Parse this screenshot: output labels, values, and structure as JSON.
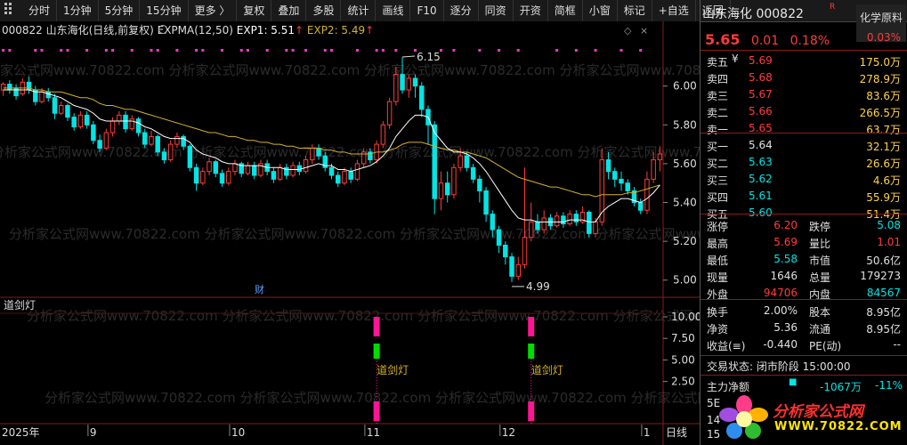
{
  "toolbar": {
    "dots_icon": "grid-dots-icon",
    "items": [
      "分时",
      "1分钟",
      "5分钟",
      "15分钟",
      "更多 〉",
      "复权",
      "叠加",
      "多股",
      "统计",
      "画线",
      "F10",
      "逐分",
      "同资",
      "开资",
      "简框",
      "小窗",
      "标记",
      "+自选",
      "返回"
    ]
  },
  "chart": {
    "info_code": "000822",
    "info_name": "山东海化(日线,前复权)",
    "expma_label": "EXPMA(12,50)",
    "exp1_label": "EXP1: 5.51",
    "exp2_label": "EXP2: 5.49",
    "y_labels": [
      "6.00",
      "5.80",
      "5.60",
      "5.40",
      "5.20",
      "5.00"
    ],
    "high_label": "6.15",
    "low_label": "4.99",
    "cai_label": "财",
    "watermark_text": "分析家公式网www.70822.com",
    "indicator_name": "道剑灯",
    "indicator_y_labels": [
      "10.00",
      "7.50",
      "5.00",
      "2.50"
    ],
    "signal_label": "道剑灯",
    "x_labels": [
      "2025年",
      "9",
      "10",
      "11",
      "12",
      "1"
    ],
    "period_label": "日线",
    "colors": {
      "up": "#ff3b3b",
      "down": "#00e5e5",
      "exp1": "#ffffff",
      "exp2": "#d4b12a",
      "pink": "#ff1493",
      "green": "#00dd00"
    }
  },
  "chart_data": [
    {
      "type": "candlestick",
      "title": "000822 山东海化(日线,前复权)",
      "y_ticks": [
        6.0,
        5.8,
        5.6,
        5.4,
        5.2,
        5.0
      ],
      "ylim": [
        4.93,
        6.26
      ],
      "annotations": {
        "high": 6.15,
        "low": 4.99
      },
      "candles": [
        [
          5.98,
          6.01,
          5.95,
          6.02
        ],
        [
          6.01,
          5.98,
          5.96,
          6.03
        ],
        [
          5.99,
          5.95,
          5.93,
          6.01
        ],
        [
          5.96,
          6.02,
          5.95,
          6.04
        ],
        [
          6.02,
          5.98,
          5.96,
          6.05
        ],
        [
          5.98,
          5.92,
          5.9,
          6.0
        ],
        [
          5.92,
          5.97,
          5.91,
          5.99
        ],
        [
          5.97,
          5.94,
          5.92,
          5.99
        ],
        [
          5.94,
          5.86,
          5.83,
          5.96
        ],
        [
          5.86,
          5.9,
          5.85,
          5.92
        ],
        [
          5.9,
          5.84,
          5.82,
          5.91
        ],
        [
          5.84,
          5.79,
          5.77,
          5.86
        ],
        [
          5.79,
          5.85,
          5.78,
          5.87
        ],
        [
          5.85,
          5.8,
          5.78,
          5.87
        ],
        [
          5.8,
          5.72,
          5.7,
          5.82
        ],
        [
          5.72,
          5.68,
          5.66,
          5.75
        ],
        [
          5.68,
          5.76,
          5.67,
          5.78
        ],
        [
          5.76,
          5.82,
          5.74,
          5.84
        ],
        [
          5.82,
          5.85,
          5.8,
          5.87
        ],
        [
          5.85,
          5.78,
          5.76,
          5.87
        ],
        [
          5.78,
          5.83,
          5.77,
          5.85
        ],
        [
          5.83,
          5.76,
          5.74,
          5.84
        ],
        [
          5.76,
          5.7,
          5.68,
          5.78
        ],
        [
          5.7,
          5.74,
          5.69,
          5.77
        ],
        [
          5.74,
          5.66,
          5.64,
          5.75
        ],
        [
          5.66,
          5.62,
          5.6,
          5.68
        ],
        [
          5.62,
          5.7,
          5.61,
          5.72
        ],
        [
          5.7,
          5.74,
          5.68,
          5.76
        ],
        [
          5.74,
          5.69,
          5.67,
          5.75
        ],
        [
          5.69,
          5.58,
          5.56,
          5.7
        ],
        [
          5.58,
          5.5,
          5.46,
          5.6
        ],
        [
          5.5,
          5.56,
          5.49,
          5.58
        ],
        [
          5.56,
          5.61,
          5.54,
          5.63
        ],
        [
          5.61,
          5.55,
          5.53,
          5.62
        ],
        [
          5.55,
          5.5,
          5.48,
          5.57
        ],
        [
          5.5,
          5.56,
          5.49,
          5.58
        ],
        [
          5.56,
          5.6,
          5.54,
          5.62
        ],
        [
          5.6,
          5.55,
          5.53,
          5.61
        ],
        [
          5.55,
          5.59,
          5.54,
          5.61
        ],
        [
          5.59,
          5.54,
          5.52,
          5.61
        ],
        [
          5.54,
          5.6,
          5.53,
          5.62
        ],
        [
          5.6,
          5.56,
          5.54,
          5.62
        ],
        [
          5.56,
          5.52,
          5.5,
          5.58
        ],
        [
          5.52,
          5.58,
          5.51,
          5.6
        ],
        [
          5.58,
          5.54,
          5.52,
          5.6
        ],
        [
          5.54,
          5.59,
          5.53,
          5.61
        ],
        [
          5.59,
          5.56,
          5.54,
          5.61
        ],
        [
          5.56,
          5.62,
          5.55,
          5.64
        ],
        [
          5.62,
          5.68,
          5.6,
          5.7
        ],
        [
          5.68,
          5.64,
          5.62,
          5.7
        ],
        [
          5.64,
          5.58,
          5.56,
          5.66
        ],
        [
          5.58,
          5.54,
          5.52,
          5.6
        ],
        [
          5.54,
          5.5,
          5.48,
          5.56
        ],
        [
          5.5,
          5.56,
          5.49,
          5.58
        ],
        [
          5.56,
          5.52,
          5.5,
          5.58
        ],
        [
          5.52,
          5.6,
          5.51,
          5.62
        ],
        [
          5.6,
          5.66,
          5.58,
          5.68
        ],
        [
          5.66,
          5.62,
          5.6,
          5.68
        ],
        [
          5.62,
          5.7,
          5.6,
          5.72
        ],
        [
          5.7,
          5.8,
          5.68,
          5.82
        ],
        [
          5.8,
          5.92,
          5.78,
          5.94
        ],
        [
          5.92,
          6.06,
          5.9,
          6.1
        ],
        [
          6.06,
          5.98,
          5.96,
          6.15
        ],
        [
          5.98,
          6.04,
          5.94,
          6.06
        ],
        [
          6.04,
          6.0,
          5.94,
          6.06
        ],
        [
          6.0,
          5.88,
          5.84,
          6.02
        ],
        [
          5.88,
          5.8,
          5.7,
          5.9
        ],
        [
          5.8,
          5.42,
          5.34,
          5.82
        ],
        [
          5.42,
          5.5,
          5.36,
          5.56
        ],
        [
          5.5,
          5.44,
          5.4,
          5.56
        ],
        [
          5.44,
          5.58,
          5.42,
          5.6
        ],
        [
          5.58,
          5.64,
          5.56,
          5.68
        ],
        [
          5.64,
          5.58,
          5.56,
          5.66
        ],
        [
          5.58,
          5.52,
          5.5,
          5.6
        ],
        [
          5.52,
          5.46,
          5.4,
          5.54
        ],
        [
          5.46,
          5.34,
          5.3,
          5.48
        ],
        [
          5.34,
          5.26,
          5.22,
          5.36
        ],
        [
          5.26,
          5.18,
          5.14,
          5.28
        ],
        [
          5.18,
          5.12,
          5.08,
          5.2
        ],
        [
          5.12,
          5.02,
          4.99,
          5.14
        ],
        [
          5.02,
          5.08,
          5.0,
          5.12
        ],
        [
          5.08,
          5.22,
          5.06,
          5.58
        ],
        [
          5.22,
          5.3,
          5.2,
          5.4
        ],
        [
          5.3,
          5.26,
          5.24,
          5.34
        ],
        [
          5.26,
          5.32,
          5.24,
          5.36
        ],
        [
          5.32,
          5.28,
          5.26,
          5.34
        ],
        [
          5.28,
          5.33,
          5.27,
          5.35
        ],
        [
          5.33,
          5.29,
          5.27,
          5.35
        ],
        [
          5.29,
          5.34,
          5.28,
          5.36
        ],
        [
          5.34,
          5.3,
          5.28,
          5.36
        ],
        [
          5.3,
          5.35,
          5.29,
          5.38
        ],
        [
          5.35,
          5.24,
          5.22,
          5.36
        ],
        [
          5.24,
          5.3,
          5.22,
          5.32
        ],
        [
          5.3,
          5.62,
          5.28,
          5.68
        ],
        [
          5.62,
          5.56,
          5.52,
          5.66
        ],
        [
          5.56,
          5.52,
          5.48,
          5.58
        ],
        [
          5.52,
          5.5,
          5.46,
          5.56
        ],
        [
          5.5,
          5.46,
          5.44,
          5.52
        ],
        [
          5.46,
          5.4,
          5.38,
          5.48
        ],
        [
          5.4,
          5.36,
          5.34,
          5.42
        ],
        [
          5.36,
          5.52,
          5.34,
          5.56
        ],
        [
          5.52,
          5.62,
          5.5,
          5.66
        ],
        [
          5.62,
          5.65,
          5.56,
          5.69
        ]
      ],
      "exp1": [
        5.98,
        5.98,
        5.98,
        5.98,
        5.98,
        5.97,
        5.97,
        5.96,
        5.95,
        5.94,
        5.92,
        5.9,
        5.89,
        5.88,
        5.86,
        5.83,
        5.82,
        5.82,
        5.82,
        5.82,
        5.82,
        5.81,
        5.79,
        5.78,
        5.76,
        5.74,
        5.73,
        5.73,
        5.73,
        5.71,
        5.67,
        5.65,
        5.64,
        5.63,
        5.61,
        5.6,
        5.6,
        5.59,
        5.59,
        5.59,
        5.59,
        5.58,
        5.58,
        5.58,
        5.57,
        5.57,
        5.57,
        5.58,
        5.59,
        5.6,
        5.59,
        5.59,
        5.57,
        5.57,
        5.56,
        5.57,
        5.58,
        5.59,
        5.61,
        5.64,
        5.68,
        5.74,
        5.78,
        5.82,
        5.85,
        5.85,
        5.84,
        5.76,
        5.72,
        5.68,
        5.66,
        5.66,
        5.65,
        5.63,
        5.6,
        5.56,
        5.51,
        5.46,
        5.41,
        5.36,
        5.32,
        5.31,
        5.31,
        5.3,
        5.3,
        5.3,
        5.3,
        5.3,
        5.31,
        5.31,
        5.31,
        5.3,
        5.3,
        5.35,
        5.38,
        5.4,
        5.42,
        5.42,
        5.41,
        5.4,
        5.42,
        5.45,
        5.49
      ],
      "exp2": [
        5.99,
        5.99,
        5.99,
        5.99,
        5.99,
        5.98,
        5.98,
        5.97,
        5.97,
        5.97,
        5.96,
        5.95,
        5.94,
        5.94,
        5.93,
        5.91,
        5.9,
        5.9,
        5.89,
        5.88,
        5.88,
        5.87,
        5.86,
        5.85,
        5.84,
        5.83,
        5.82,
        5.81,
        5.8,
        5.79,
        5.78,
        5.77,
        5.76,
        5.76,
        5.75,
        5.74,
        5.74,
        5.73,
        5.72,
        5.72,
        5.71,
        5.71,
        5.7,
        5.7,
        5.69,
        5.69,
        5.68,
        5.68,
        5.68,
        5.68,
        5.67,
        5.67,
        5.66,
        5.66,
        5.65,
        5.65,
        5.65,
        5.65,
        5.66,
        5.66,
        5.67,
        5.68,
        5.7,
        5.71,
        5.71,
        5.71,
        5.7,
        5.69,
        5.68,
        5.67,
        5.67,
        5.66,
        5.66,
        5.65,
        5.64,
        5.63,
        5.61,
        5.59,
        5.57,
        5.55,
        5.53,
        5.52,
        5.51,
        5.5,
        5.49,
        5.48,
        5.48,
        5.47,
        5.46,
        5.45,
        5.44,
        5.44,
        5.43,
        5.44,
        5.44,
        5.44,
        5.44,
        5.45,
        5.45,
        5.46,
        5.47,
        5.48,
        5.49
      ]
    },
    {
      "type": "bar",
      "title": "道剑灯",
      "y_ticks": [
        10.0,
        7.5,
        5.0,
        2.5
      ],
      "signals": [
        {
          "index": 58,
          "label": "道剑灯"
        },
        {
          "index": 82,
          "label": "道剑灯"
        }
      ]
    }
  ],
  "quote": {
    "code": "000822",
    "name": "山东海化",
    "r_badge": "R",
    "price": "5.65",
    "change": "0.01",
    "change_pct": "0.18%",
    "industry": "化学原料",
    "industry_pct": "0.03%",
    "order_book": [
      {
        "label": "卖五",
        "price": "5.69",
        "vol": "175.0万",
        "price_color": "red"
      },
      {
        "label": "卖四",
        "price": "5.68",
        "vol": "278.9万",
        "price_color": "red"
      },
      {
        "label": "卖三",
        "price": "5.67",
        "vol": "83.6万",
        "price_color": "red"
      },
      {
        "label": "卖二",
        "price": "5.66",
        "vol": "266.5万",
        "price_color": "red"
      },
      {
        "label": "卖一",
        "price": "5.65",
        "vol": "63.7万",
        "price_color": "red"
      },
      {
        "label": "买一",
        "price": "5.64",
        "vol": "32.1万",
        "price_color": "white"
      },
      {
        "label": "买二",
        "price": "5.63",
        "vol": "26.6万",
        "price_color": "cyan"
      },
      {
        "label": "买三",
        "price": "5.62",
        "vol": "4.6万",
        "price_color": "cyan"
      },
      {
        "label": "买四",
        "price": "5.61",
        "vol": "55.9万",
        "price_color": "cyan"
      },
      {
        "label": "买五",
        "price": "5.60",
        "vol": "51.4万",
        "price_color": "cyan"
      }
    ],
    "yen": "¥",
    "stats": [
      {
        "l1": "涨停",
        "v1": "6.20",
        "c1": "red",
        "l2": "跌停",
        "v2": "5.08",
        "c2": "cyan"
      },
      {
        "l1": "最高",
        "v1": "5.69",
        "c1": "red",
        "l2": "量比",
        "v2": "1.01",
        "c2": "red"
      },
      {
        "l1": "最低",
        "v1": "5.58",
        "c1": "cyan",
        "l2": "市值",
        "v2": "50.6亿",
        "c2": "white"
      },
      {
        "l1": "现量",
        "v1": "1646",
        "c1": "white",
        "l2": "总量",
        "v2": "179273",
        "c2": "white"
      },
      {
        "l1": "外盘",
        "v1": "94706",
        "c1": "red",
        "l2": "内盘",
        "v2": "84567",
        "c2": "cyan"
      }
    ],
    "stats2": [
      {
        "l1": "换手",
        "v1": "2.00%",
        "l2": "股本",
        "v2": "8.95亿"
      },
      {
        "l1": "净资",
        "v1": "5.36",
        "l2": "流通",
        "v2": "8.95亿"
      },
      {
        "l1": "收益(≡)",
        "v1": "-0.440",
        "l2": "PE(动)",
        "v2": "--"
      }
    ],
    "trade_status": "交易状态: 闭市阶段 15:00:00",
    "main_flow_label": "主力净额",
    "main_flow_value": "-1067万",
    "main_flow_pct": "-11%",
    "row5": "5E",
    "row14": "14",
    "row15": "15"
  },
  "watermark": {
    "site_name": "分析家公式网",
    "url": "WWW.70822.COM"
  }
}
